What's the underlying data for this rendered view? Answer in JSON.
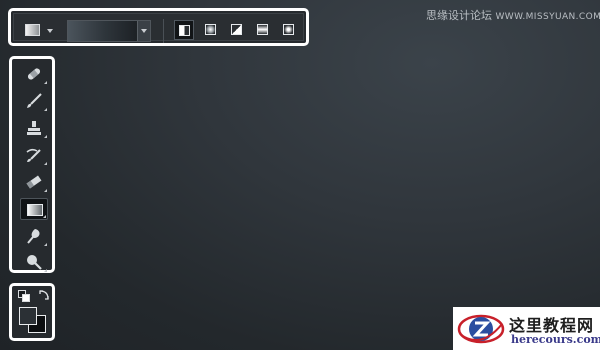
{
  "options_bar": {
    "preset_icon": "gradient-preset-icon",
    "picker_icon": "gradient-picker-dropdown",
    "gradient_types": [
      {
        "name": "linear-gradient-icon",
        "active": true
      },
      {
        "name": "radial-gradient-icon",
        "active": false
      },
      {
        "name": "angle-gradient-icon",
        "active": false
      },
      {
        "name": "reflected-gradient-icon",
        "active": false
      },
      {
        "name": "diamond-gradient-icon",
        "active": false
      }
    ],
    "gradient_colors": [
      "#4b545c",
      "#16191c"
    ]
  },
  "tools": [
    {
      "name": "healing-brush-icon",
      "active": false
    },
    {
      "name": "brush-icon",
      "active": false
    },
    {
      "name": "clone-stamp-icon",
      "active": false
    },
    {
      "name": "history-brush-icon",
      "active": false
    },
    {
      "name": "eraser-icon",
      "active": false
    },
    {
      "name": "gradient-tool-icon",
      "active": true
    },
    {
      "name": "blur-tool-icon",
      "active": false
    },
    {
      "name": "dodge-tool-icon",
      "active": false
    }
  ],
  "colors": {
    "foreground": "#2b3035",
    "background": "#0c0e10"
  },
  "watermarks": {
    "top_cn": "思缘设计论坛",
    "top_en": "WWW.MISSYUAN.COM",
    "box_cn": "这里教程网",
    "box_en": "herecours.com"
  }
}
